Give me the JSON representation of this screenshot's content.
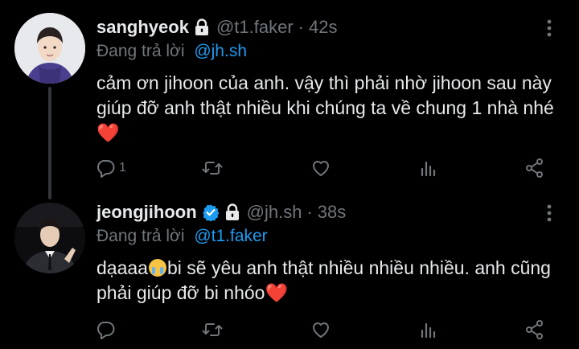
{
  "tweets": [
    {
      "name": "sanghyeok",
      "protected": true,
      "verified": false,
      "handle": "@t1.faker",
      "separator": "·",
      "time": "42s",
      "reply_prefix": "Đang trả lời",
      "reply_to": "@jh.sh",
      "text_parts": [
        "cảm ơn jihoon của anh. vậy thì phải nhờ jihoon sau này giúp đỡ anh thật nhiều khi chúng ta về chung 1 nhà nhé",
        "❤️"
      ],
      "reply_count": "1"
    },
    {
      "name": "jeongjihoon",
      "protected": true,
      "verified": true,
      "handle": "@jh.sh",
      "separator": "·",
      "time": "38s",
      "reply_prefix": "Đang trả lời",
      "reply_to": "@t1.faker",
      "text_parts": [
        "dạaaa",
        "😭",
        "bi sẽ yêu anh thật nhiều nhiều nhiều. anh cũng phải giúp đỡ bi nhóo",
        "❤️"
      ],
      "reply_count": ""
    }
  ],
  "icons": [
    "lock-icon",
    "verified-badge-icon",
    "more-icon",
    "reply-icon",
    "retweet-icon",
    "like-icon",
    "analytics-icon",
    "share-icon"
  ],
  "colors": {
    "background": "#000000",
    "text": "#e7e9ea",
    "muted": "#71767b",
    "link": "#1d9bf0",
    "verified": "#1d9bf0",
    "heart": "#f91880"
  }
}
